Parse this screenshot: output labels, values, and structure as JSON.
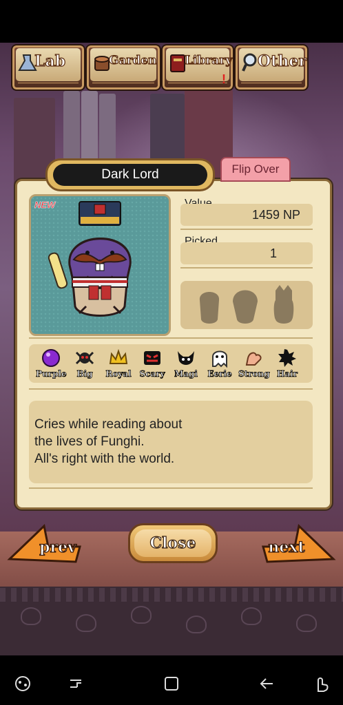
{
  "tabs": [
    {
      "label": "Lab",
      "icon": "beaker-icon"
    },
    {
      "label": "Garden",
      "icon": "stump-icon"
    },
    {
      "label": "Library",
      "icon": "book-icon",
      "badge": "!"
    },
    {
      "label": "Other",
      "icon": "magnifier-icon"
    }
  ],
  "card": {
    "name": "Dark Lord",
    "flip_label": "Flip Over",
    "new_badge": "NEW",
    "value_label": "Value",
    "value": "1459 NP",
    "picked_label": "Picked",
    "picked": "1",
    "traits": [
      {
        "label": "Purple",
        "icon": "purple-orb-icon"
      },
      {
        "label": "Big",
        "icon": "big-spider-icon"
      },
      {
        "label": "Royal",
        "icon": "crown-icon"
      },
      {
        "label": "Scary",
        "icon": "scary-mask-icon"
      },
      {
        "label": "Magi",
        "icon": "demon-icon"
      },
      {
        "label": "Eerie",
        "icon": "ghost-icon"
      },
      {
        "label": "Strong",
        "icon": "arm-icon"
      },
      {
        "label": "Hair",
        "icon": "hair-icon"
      }
    ],
    "description": "Cries while reading about\nthe lives of Funghi.\nAll's right with the world."
  },
  "nav": {
    "prev": "prev",
    "close": "Close",
    "next": "next"
  },
  "colors": {
    "panel": "#f3e7c2",
    "accent": "#f08a2a",
    "title_bg": "#1a1a1a",
    "flip": "#f3a0a8"
  }
}
